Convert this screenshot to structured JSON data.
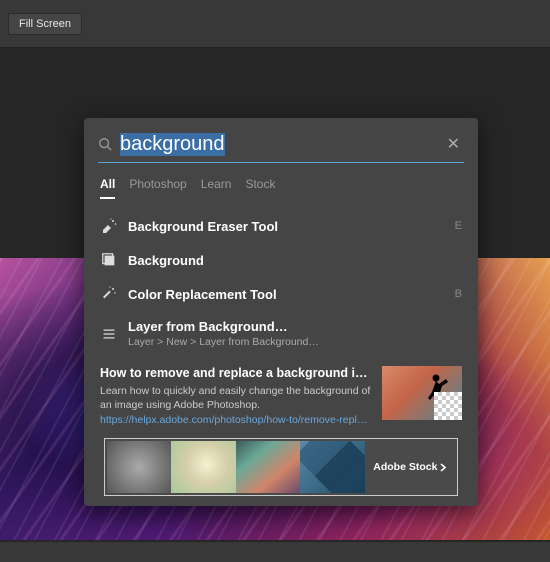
{
  "toolbar": {
    "fill_screen": "Fill Screen"
  },
  "search": {
    "query": "background",
    "tabs": [
      "All",
      "Photoshop",
      "Learn",
      "Stock"
    ],
    "active_tab": 0
  },
  "results": [
    {
      "icon": "eraser-sparkle-icon",
      "title": "Background Eraser Tool",
      "shortcut": "E"
    },
    {
      "icon": "layer-icon",
      "title": "Background",
      "shortcut": ""
    },
    {
      "icon": "wand-sparkle-icon",
      "title": "Color Replacement Tool",
      "shortcut": "B"
    },
    {
      "icon": "menu-icon",
      "title": "Layer from Background…",
      "sub": "Layer > New > Layer from Background…"
    }
  ],
  "learn": {
    "title": "How to remove and replace a background in Phot…",
    "desc": "Learn how to quickly and easily change the background of an image using Adobe Photoshop.",
    "link": "https://helpx.adobe.com/photoshop/how-to/remove-replace-back…"
  },
  "stock": {
    "label": "Adobe Stock"
  }
}
